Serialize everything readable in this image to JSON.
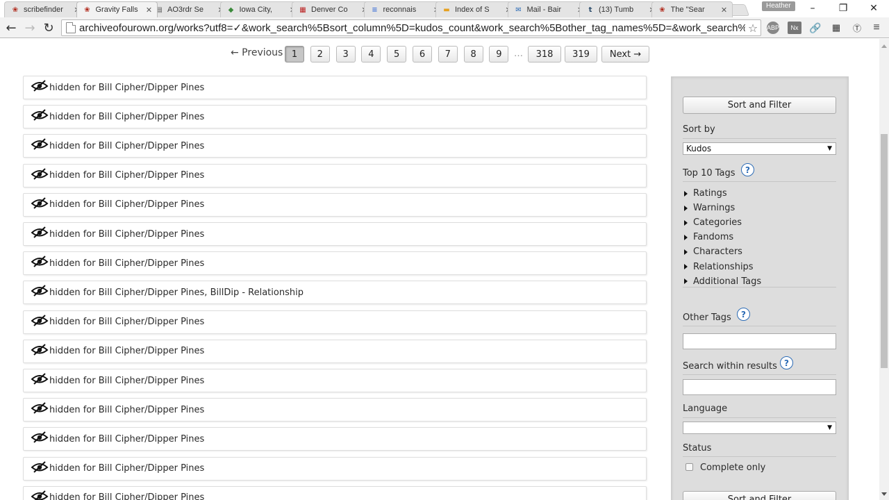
{
  "browser": {
    "tabs": [
      {
        "label": "scribefinder",
        "icon": "ao3-icon"
      },
      {
        "label": "Gravity Falls",
        "icon": "ao3-icon"
      },
      {
        "label": "AO3rdr Se",
        "icon": "extension-icon"
      },
      {
        "label": "Iowa City,",
        "icon": "maps-icon"
      },
      {
        "label": "Denver Co",
        "icon": "calendar-icon"
      },
      {
        "label": "reconnais",
        "icon": "docs-icon"
      },
      {
        "label": "Index of S",
        "icon": "folder-icon"
      },
      {
        "label": "Mail - Bair",
        "icon": "mail-icon"
      },
      {
        "label": "(13) Tumb",
        "icon": "tumblr-icon"
      },
      {
        "label": "The \"Sear",
        "icon": "ao3-icon"
      }
    ],
    "active_tab": 1,
    "profile_name": "Heather",
    "url": "archiveofourown.org/works?utf8=✓&work_search%5Bsort_column%5D=kudos_count&work_search%5Bother_tag_names%5D=&work_search%5B",
    "extensions": [
      "ABP",
      "Nx"
    ]
  },
  "pagination": {
    "prev_label": "← Previous",
    "pages": [
      "1",
      "2",
      "3",
      "4",
      "5",
      "6",
      "7",
      "8",
      "9"
    ],
    "gap": "…",
    "last_pages": [
      "318",
      "319"
    ],
    "current": "1",
    "next_label": "Next →"
  },
  "works": [
    "hidden for Bill Cipher/Dipper Pines",
    "hidden for Bill Cipher/Dipper Pines",
    "hidden for Bill Cipher/Dipper Pines",
    "hidden for Bill Cipher/Dipper Pines",
    "hidden for Bill Cipher/Dipper Pines",
    "hidden for Bill Cipher/Dipper Pines",
    "hidden for Bill Cipher/Dipper Pines",
    "hidden for Bill Cipher/Dipper Pines, BillDip - Relationship",
    "hidden for Bill Cipher/Dipper Pines",
    "hidden for Bill Cipher/Dipper Pines",
    "hidden for Bill Cipher/Dipper Pines",
    "hidden for Bill Cipher/Dipper Pines",
    "hidden for Bill Cipher/Dipper Pines",
    "hidden for Bill Cipher/Dipper Pines",
    "hidden for Bill Cipher/Dipper Pines"
  ],
  "filters": {
    "sort_filter_button": "Sort and Filter",
    "sort_by_label": "Sort by",
    "sort_by_value": "Kudos",
    "top_tags_label": "Top 10 Tags",
    "tag_groups": [
      "Ratings",
      "Warnings",
      "Categories",
      "Fandoms",
      "Characters",
      "Relationships",
      "Additional Tags"
    ],
    "other_tags_label": "Other Tags",
    "search_within_label": "Search within results",
    "language_label": "Language",
    "language_value": "",
    "status_label": "Status",
    "complete_only_label": "Complete only",
    "help_glyph": "?"
  }
}
